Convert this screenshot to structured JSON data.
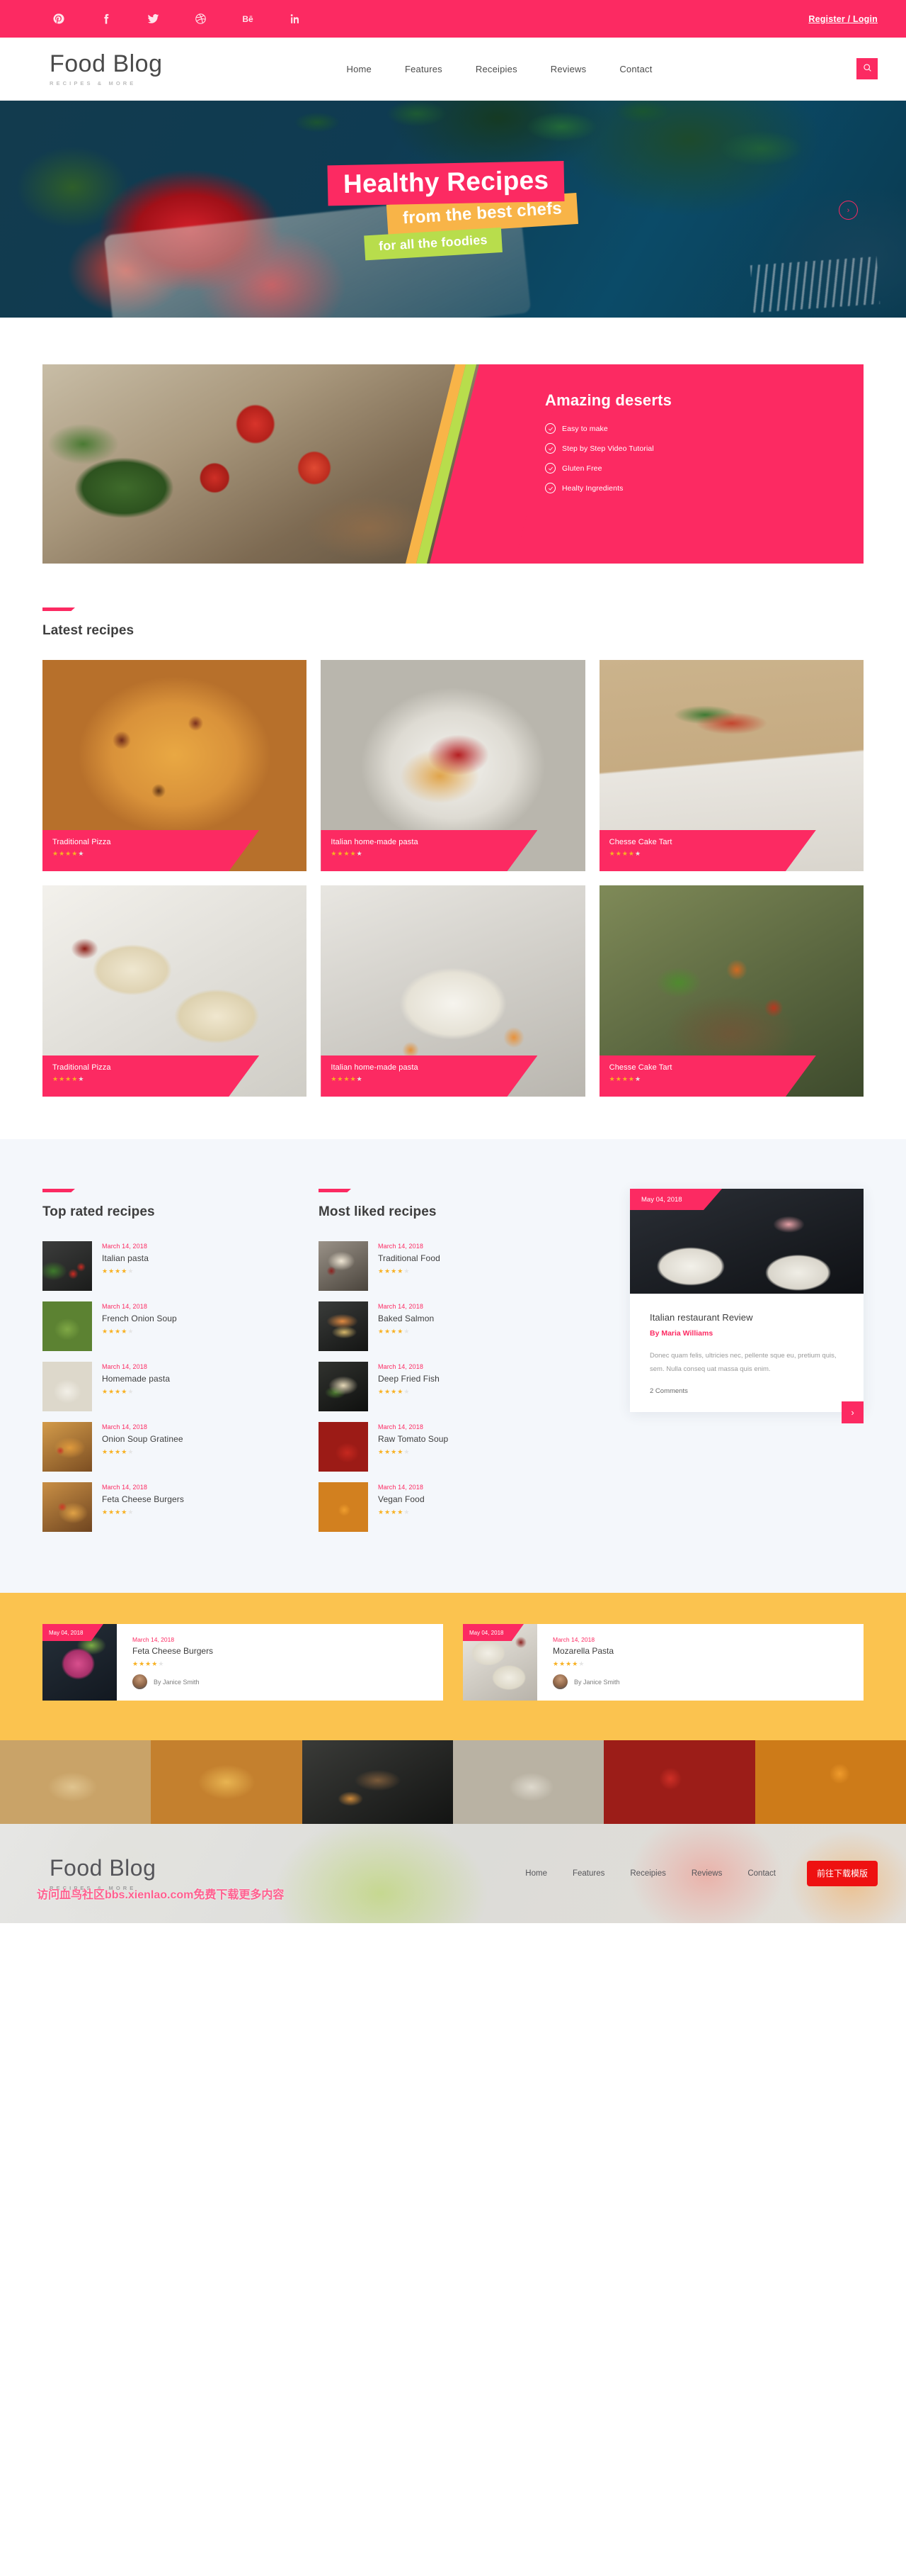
{
  "topbar": {
    "social": [
      {
        "name": "pinterest-icon"
      },
      {
        "name": "facebook-icon"
      },
      {
        "name": "twitter-icon"
      },
      {
        "name": "dribbble-icon"
      },
      {
        "name": "behance-icon"
      },
      {
        "name": "linkedin-icon"
      }
    ],
    "register_login": "Register / Login",
    "bg_color": "#fc2a62"
  },
  "header": {
    "brand_title": "Food Blog",
    "brand_sub": "RECIPES & MORE",
    "nav": [
      {
        "label": "Home"
      },
      {
        "label": "Features"
      },
      {
        "label": "Receipies"
      },
      {
        "label": "Reviews"
      },
      {
        "label": "Contact"
      }
    ],
    "search_icon": "search-icon"
  },
  "hero": {
    "line1": "Healthy Recipes",
    "line2": "from the best chefs",
    "line3": "for all the foodies",
    "next_label": "›",
    "colors": {
      "line1": "#fc2a62",
      "line2": "#f8b448",
      "line3": "#b8dd4c"
    }
  },
  "deserts": {
    "title": "Amazing deserts",
    "features": [
      {
        "label": "Easy to make"
      },
      {
        "label": "Step by Step Video Tutorial"
      },
      {
        "label": "Gluten Free"
      },
      {
        "label": "Healty Ingredients"
      }
    ]
  },
  "latest": {
    "section_title": "Latest recipes",
    "cards": [
      {
        "name": "Traditional Pizza",
        "rating": 4,
        "max": 5
      },
      {
        "name": "Italian home-made pasta",
        "rating": 4,
        "max": 5
      },
      {
        "name": "Chesse Cake Tart",
        "rating": 4,
        "max": 5
      },
      {
        "name": "Traditional Pizza",
        "rating": 4,
        "max": 5
      },
      {
        "name": "Italian home-made pasta",
        "rating": 4,
        "max": 5
      },
      {
        "name": "Chesse Cake Tart",
        "rating": 4,
        "max": 5
      }
    ]
  },
  "top_rated": {
    "section_title": "Top rated recipes",
    "items": [
      {
        "date": "March 14, 2018",
        "title": "Italian pasta",
        "rating": 4,
        "max": 5
      },
      {
        "date": "March 14, 2018",
        "title": "French Onion Soup",
        "rating": 4,
        "max": 5
      },
      {
        "date": "March 14, 2018",
        "title": "Homemade pasta",
        "rating": 4,
        "max": 5
      },
      {
        "date": "March 14, 2018",
        "title": "Onion Soup Gratinee",
        "rating": 4,
        "max": 5
      },
      {
        "date": "March 14, 2018",
        "title": "Feta Cheese Burgers",
        "rating": 4,
        "max": 5
      }
    ]
  },
  "most_liked": {
    "section_title": "Most liked recipes",
    "items": [
      {
        "date": "March 14, 2018",
        "title": "Traditional Food",
        "rating": 4,
        "max": 5
      },
      {
        "date": "March 14, 2018",
        "title": "Baked Salmon",
        "rating": 4,
        "max": 5
      },
      {
        "date": "March 14, 2018",
        "title": "Deep Fried Fish",
        "rating": 4,
        "max": 5
      },
      {
        "date": "March 14, 2018",
        "title": "Raw Tomato Soup",
        "rating": 4,
        "max": 5
      },
      {
        "date": "March 14, 2018",
        "title": "Vegan Food",
        "rating": 4,
        "max": 5
      }
    ]
  },
  "review": {
    "badge_date": "May 04, 2018",
    "title": "Italian restaurant Review",
    "author": "By Maria Williams",
    "text": "Donec quam felis, ultricies nec, pellente sque eu, pretium quis, sem. Nulla conseq uat massa quis enim.",
    "comments": "2 Comments",
    "next_label": "›"
  },
  "featured": {
    "cards": [
      {
        "badge_date": "May 04, 2018",
        "date": "March 14, 2018",
        "title": "Feta Cheese Burgers",
        "rating": 4,
        "max": 5,
        "author": "By Janice Smith"
      },
      {
        "badge_date": "May 04, 2018",
        "date": "March 14, 2018",
        "title": "Mozarella Pasta",
        "rating": 4,
        "max": 5,
        "author": "By Janice Smith"
      }
    ]
  },
  "footer": {
    "brand_title": "Food Blog",
    "brand_sub": "RECIPES & MORE",
    "nav": [
      {
        "label": "Home"
      },
      {
        "label": "Features"
      },
      {
        "label": "Receipies"
      },
      {
        "label": "Reviews"
      },
      {
        "label": "Contact"
      }
    ],
    "download_button": "前往下载模版",
    "watermark": "访问血鸟社区bbs.xienlao.com免费下载更多内容"
  }
}
